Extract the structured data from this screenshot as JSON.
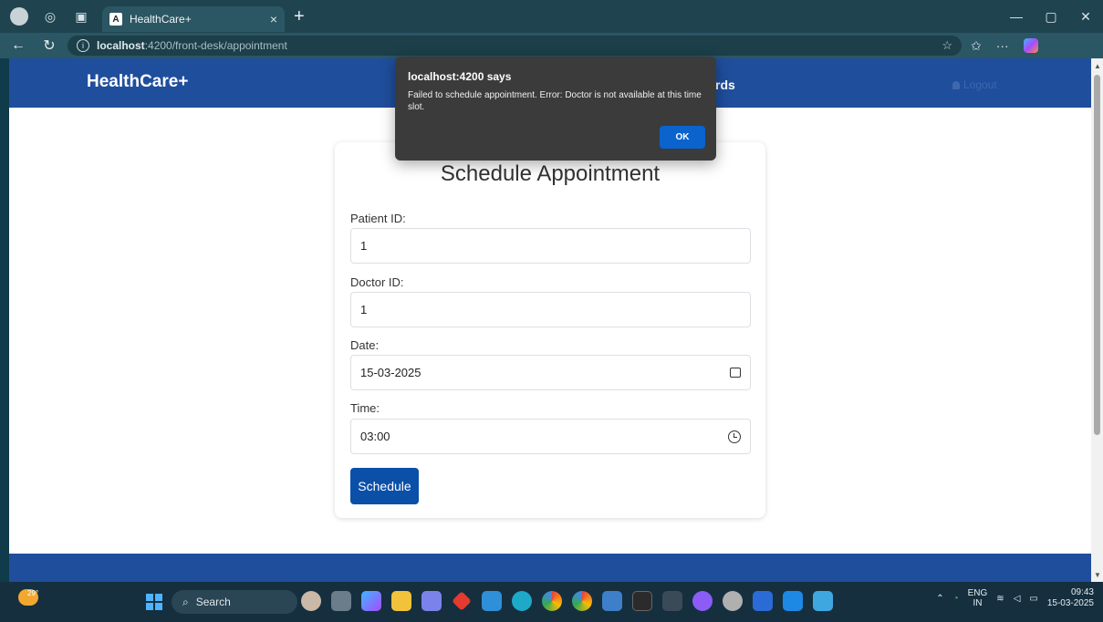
{
  "browser": {
    "tab_title": "HealthCare+",
    "tab_favicon": "A",
    "url_host": "localhost",
    "url_path": ":4200/front-desk/appointment",
    "new_tab": "+",
    "tab_close": "×",
    "win_min": "—",
    "win_max": "▢",
    "win_close": "✕",
    "more": "···"
  },
  "app": {
    "brand": "HealthCare+",
    "nav_link_partial": "rds",
    "logout": "Logout"
  },
  "form": {
    "title": "Schedule Appointment",
    "patient_label": "Patient ID:",
    "patient_value": "1",
    "doctor_label": "Doctor ID:",
    "doctor_value": "1",
    "date_label": "Date:",
    "date_value": "15-03-2025",
    "time_label": "Time:",
    "time_value": "03:00",
    "submit": "Schedule"
  },
  "dialog": {
    "title": "localhost:4200 says",
    "message": "Failed to schedule appointment. Error: Doctor is not available at this time slot.",
    "ok": "OK"
  },
  "taskbar": {
    "weather": "29°",
    "search": "Search",
    "lang_top": "ENG",
    "lang_bottom": "IN",
    "time": "09:43",
    "date": "15-03-2025"
  },
  "colors": {
    "navbar": "#1f4e9c",
    "button": "#0a4fa8",
    "dialog_ok": "#0b63ce"
  }
}
